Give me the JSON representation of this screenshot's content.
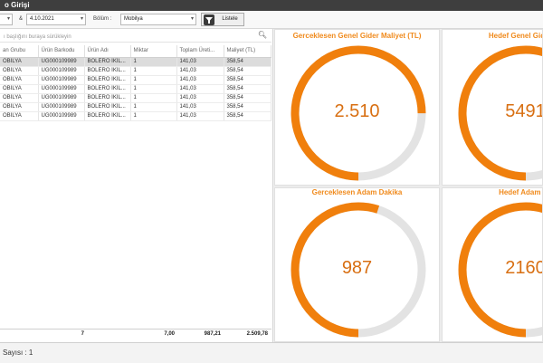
{
  "window": {
    "title": "o Girişi"
  },
  "filters": {
    "date_separator": "&",
    "date_end": "4.10.2021",
    "section_label": "Bölüm :",
    "section_value": "Mobilya",
    "list_button": "Listele"
  },
  "grid": {
    "group_hint": "ı başlığını buraya sürükleyin",
    "columns": [
      "an Grubu",
      "Ürün Barkodu",
      "Ürün Adı",
      "Miktar",
      "Toplam Üreti...",
      "Maliyet (TL)"
    ],
    "rows": [
      [
        "OBİLYA",
        "UG000109989",
        "BOLERO İKİL...",
        "1",
        "141,03",
        "358,54"
      ],
      [
        "OBİLYA",
        "UG000109989",
        "BOLERO İKİL...",
        "1",
        "141,03",
        "358,54"
      ],
      [
        "OBİLYA",
        "UG000109989",
        "BOLERO İKİL...",
        "1",
        "141,03",
        "358,54"
      ],
      [
        "OBİLYA",
        "UG000109989",
        "BOLERO İKİL...",
        "1",
        "141,03",
        "358,54"
      ],
      [
        "OBİLYA",
        "UG000109989",
        "BOLERO İKİL...",
        "1",
        "141,03",
        "358,54"
      ],
      [
        "OBİLYA",
        "UG000109989",
        "BOLERO İKİL...",
        "1",
        "141,03",
        "358,54"
      ],
      [
        "OBİLYA",
        "UG000109989",
        "BOLERO İKİL...",
        "1",
        "141,03",
        "358,54"
      ]
    ],
    "totals": {
      "count": "7",
      "quantity": "7,00",
      "production": "987,21",
      "cost": "2.509,78"
    }
  },
  "cards": [
    {
      "title": "Gerceklesen Genel Gider Maliyet (TL)",
      "value": "2.510",
      "fraction": 0.75
    },
    {
      "title": "Hedef Genel Gider To",
      "value": "5491",
      "fraction": 0.75
    },
    {
      "title": "Gerceklesen Adam Dakika",
      "value": "987",
      "fraction": 0.55
    },
    {
      "title": "Hedef Adam Da",
      "value": "2160",
      "fraction": 0.75
    }
  ],
  "status": {
    "text": "Sayısı : 1"
  },
  "colors": {
    "accent": "#f08a1c",
    "gauge_track": "#e3e3e3",
    "gauge_fill": "#f07f0c"
  }
}
